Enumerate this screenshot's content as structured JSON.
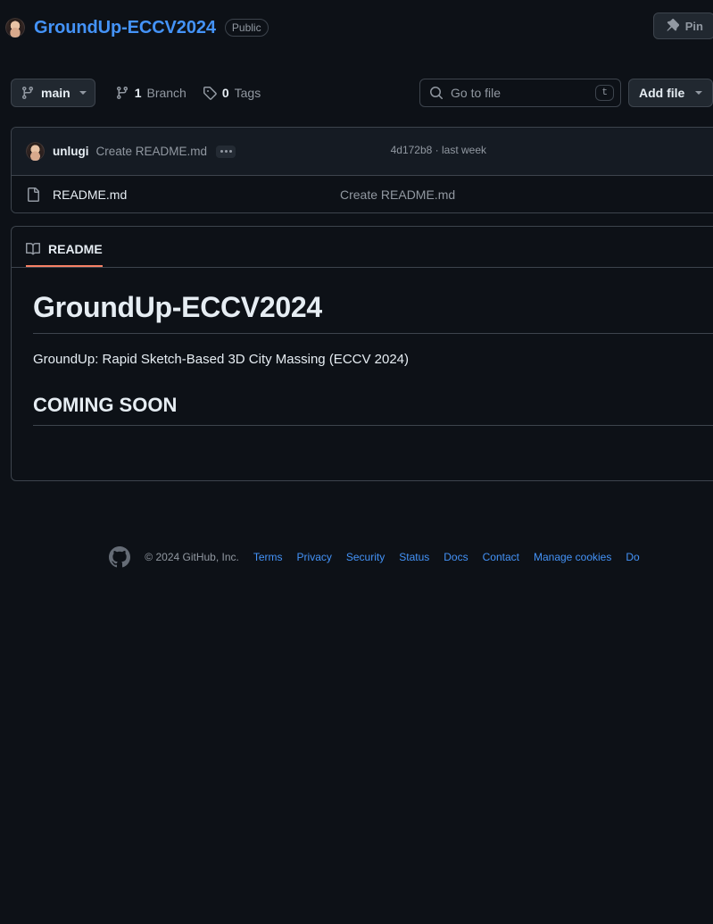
{
  "repo": {
    "owner_avatar": "owner-avatar",
    "name": "GroundUp-ECCV2024",
    "visibility": "Public",
    "pin_label": "Pin"
  },
  "toolbar": {
    "branch": "main",
    "branch_count": "1",
    "branch_word": "Branch",
    "tag_count": "0",
    "tag_word": "Tags",
    "search_placeholder": "Go to file",
    "search_value": "",
    "search_shortcut": "t",
    "add_file_label": "Add file",
    "code_label": ""
  },
  "commit": {
    "author": "unlugi",
    "message": "Create README.md",
    "hash_and_time": "4d172b8 · last week"
  },
  "files": [
    {
      "name": "README.md",
      "commit_message": "Create README.md",
      "icon": "file-icon"
    }
  ],
  "readme": {
    "tab_label": "README",
    "heading": "GroundUp-ECCV2024",
    "paragraph": "GroundUp: Rapid Sketch-Based 3D City Massing (ECCV 2024)",
    "subheading": "COMING SOON"
  },
  "footer": {
    "copyright": "© 2024 GitHub, Inc.",
    "links": [
      "Terms",
      "Privacy",
      "Security",
      "Status",
      "Docs",
      "Contact",
      "Manage cookies",
      "Do"
    ]
  },
  "colors": {
    "page_bg": "#0d1117",
    "panel_border": "#3d444d",
    "link_blue": "#4493f8",
    "muted": "#9198a1",
    "accent_underline": "#f78166",
    "code_green": "#238636"
  }
}
